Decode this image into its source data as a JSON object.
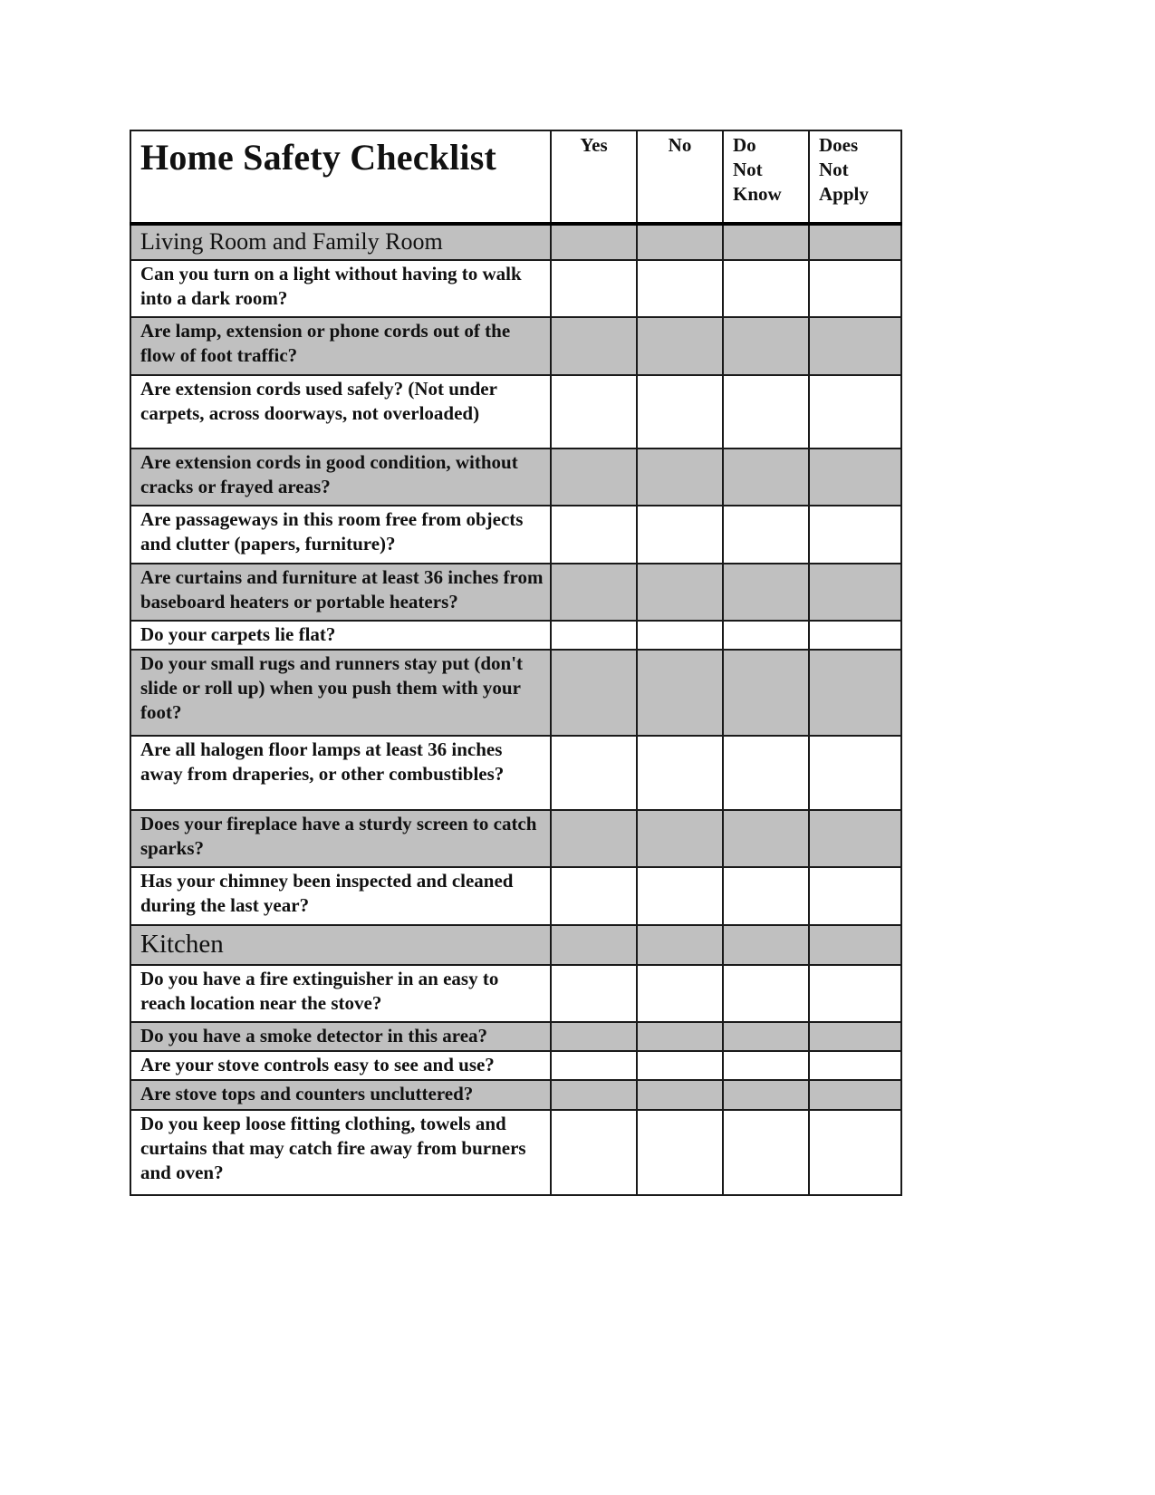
{
  "title": "Home Safety Checklist",
  "columns": [
    "Yes",
    "No",
    "Do Not Know",
    "Does Not Apply"
  ],
  "column_lines": [
    [
      "Yes"
    ],
    [
      "No"
    ],
    [
      "Do",
      "Not",
      "Know"
    ],
    [
      "Does",
      "Not",
      "Apply"
    ]
  ],
  "sections": [
    {
      "name": "Living Room and Family Room",
      "questions": [
        "Can you turn on a light without having to walk into a dark room?",
        "Are lamp, extension or phone cords out of the flow of foot traffic?",
        "Are extension cords used safely? (Not under carpets, across doorways, not overloaded)",
        "Are extension cords in good condition, without cracks or frayed areas?",
        "Are passageways in this room free from objects and clutter (papers, furniture)?",
        "Are curtains and furniture at least 36 inches from baseboard heaters or portable heaters?",
        "Do your carpets lie flat?",
        "Do your small rugs and runners stay put (don't slide or roll up) when you push them with your foot?",
        "Are all halogen floor lamps at least 36 inches away from draperies, or other combustibles?",
        "Does your fireplace have a sturdy screen to catch sparks?",
        "Has your chimney been inspected and cleaned during the last year?"
      ]
    },
    {
      "name": "Kitchen",
      "questions": [
        "Do you have a fire extinguisher in an easy to reach location near the stove?",
        "Do you have a smoke detector in this area?",
        "Are your stove controls easy to see and use?",
        "Are stove tops and counters uncluttered?",
        "Do you keep loose fitting clothing, towels and curtains that may catch fire away from burners and oven?"
      ]
    }
  ],
  "colors": {
    "shade": "#c0c0c0",
    "border": "#1a1a1a",
    "text": "#111111"
  }
}
